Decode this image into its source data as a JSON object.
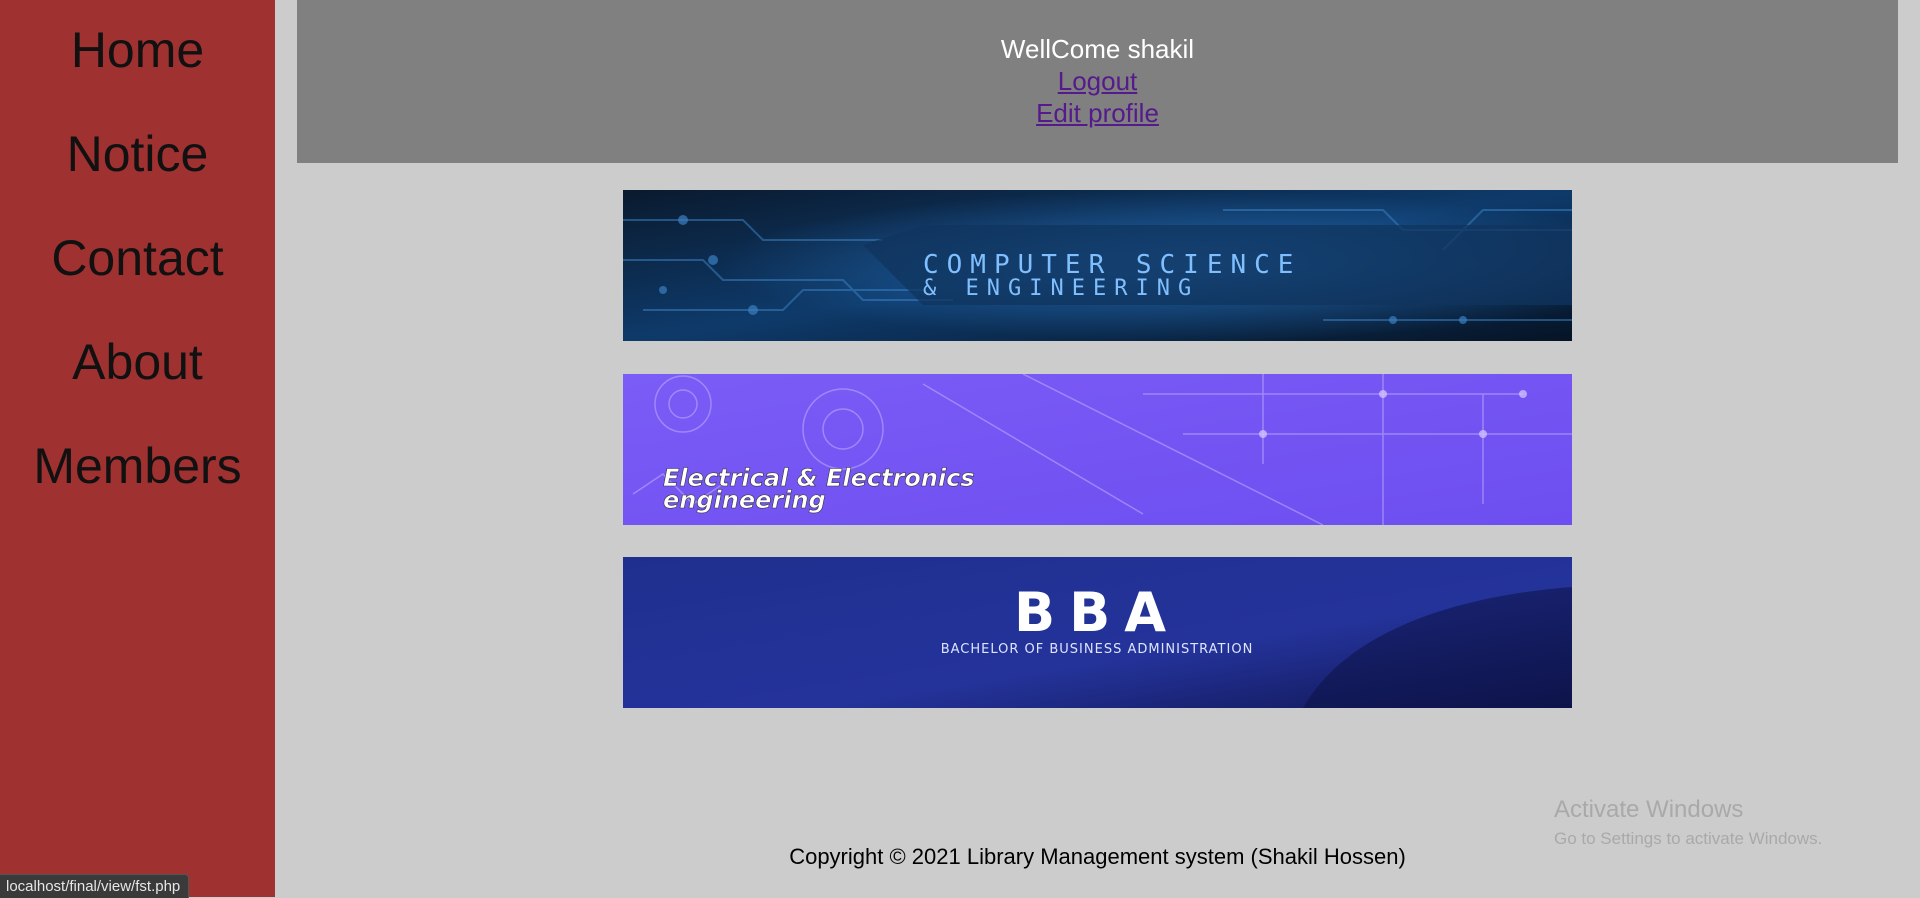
{
  "sidebar": {
    "bg_color": "#a03131",
    "items": [
      {
        "label": "Home"
      },
      {
        "label": "Notice"
      },
      {
        "label": "Contact"
      },
      {
        "label": "About"
      },
      {
        "label": "Members"
      }
    ]
  },
  "header": {
    "welcome": "WellCome shakil",
    "logout": "Logout",
    "edit_profile": "Edit profile",
    "bg_color": "#808080"
  },
  "banners": [
    {
      "name": "cse",
      "line1": "COMPUTER SCIENCE",
      "line2": "& ENGINEERING"
    },
    {
      "name": "eee",
      "line1": "Electrical & Electronics",
      "line2": "engineering"
    },
    {
      "name": "bba",
      "line1": "BBA",
      "line2": "BACHELOR OF BUSINESS ADMINISTRATION"
    }
  ],
  "footer": {
    "text": "Copyright © 2021 Library Management system (Shakil Hossen)"
  },
  "watermark": {
    "title": "Activate Windows",
    "subtitle": "Go to Settings to activate Windows."
  },
  "status_bar": {
    "url": "localhost/final/view/fst.php"
  },
  "colors": {
    "page_bg": "#cccccc",
    "link": "#551a8b"
  }
}
